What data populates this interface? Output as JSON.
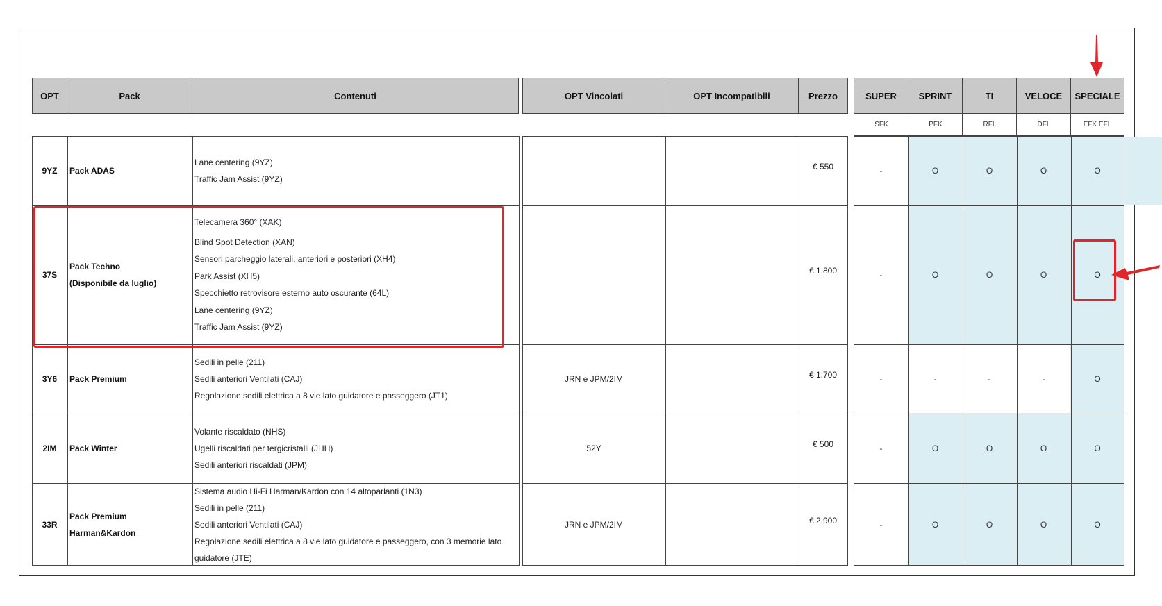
{
  "headers": {
    "opt": "OPT",
    "pack": "Pack",
    "contenuti": "Contenuti",
    "vincolati": "OPT Vincolati",
    "incompatibili": "OPT Incompatibili",
    "prezzo": "Prezzo"
  },
  "trims": [
    {
      "name": "SUPER",
      "code": "SFK"
    },
    {
      "name": "SPRINT",
      "code": "PFK"
    },
    {
      "name": "TI",
      "code": "RFL"
    },
    {
      "name": "VELOCE",
      "code": "DFL"
    },
    {
      "name": "SPECIALE",
      "code": "EFK EFL"
    }
  ],
  "rows": [
    {
      "opt": "9YZ",
      "pack": [
        "Pack ADAS"
      ],
      "contents": [
        "Lane centering (9YZ)",
        "Traffic Jam Assist (9YZ)"
      ],
      "vincolati": "",
      "incompatibili": "",
      "price": "€ 550",
      "trims": [
        "-",
        "O",
        "O",
        "O",
        "O"
      ]
    },
    {
      "opt": "37S",
      "pack": [
        "Pack Techno",
        "(Disponibile da luglio)"
      ],
      "contents": [
        "Telecamera 360° (XAK)",
        "Blind Spot Detection (XAN)",
        "Sensori parcheggio laterali, anteriori e posteriori (XH4)",
        "Park Assist (XH5)",
        "Specchietto retrovisore esterno auto oscurante (64L)",
        "Lane centering (9YZ)",
        "Traffic Jam Assist (9YZ)"
      ],
      "vincolati": "",
      "incompatibili": "",
      "price": "€ 1.800",
      "trims": [
        "-",
        "O",
        "O",
        "O",
        "O"
      ]
    },
    {
      "opt": "3Y6",
      "pack": [
        "Pack Premium"
      ],
      "contents": [
        "Sedili in pelle (211)",
        "Sedili anteriori Ventilati (CAJ)",
        "Regolazione sedili elettrica a 8 vie lato guidatore e passeggero (JT1)"
      ],
      "vincolati": "JRN e JPM/2IM",
      "incompatibili": "",
      "price": "€ 1.700",
      "trims": [
        "-",
        "-",
        "-",
        "-",
        "O"
      ]
    },
    {
      "opt": "2IM",
      "pack": [
        "Pack Winter"
      ],
      "contents": [
        "Volante riscaldato (NHS)",
        "Ugelli riscaldati per tergicristalli (JHH)",
        "Sedili anteriori riscaldati (JPM)"
      ],
      "vincolati": "52Y",
      "incompatibili": "",
      "price": "€ 500",
      "trims": [
        "-",
        "O",
        "O",
        "O",
        "O"
      ]
    },
    {
      "opt": "33R",
      "pack": [
        "Pack Premium",
        "Harman&Kardon"
      ],
      "contents": [
        "Sistema audio Hi-Fi Harman/Kardon con 14 altoparlanti (1N3)",
        "Sedili in pelle (211)",
        "Sedili anteriori Ventilati (CAJ)",
        "Regolazione sedili elettrica a 8 vie lato guidatore e passeggero, con 3 memorie lato",
        "guidatore (JTE)"
      ],
      "vincolati": "JRN e JPM/2IM",
      "incompatibili": "",
      "price": "€ 2.900",
      "trims": [
        "-",
        "O",
        "O",
        "O",
        "O"
      ]
    }
  ],
  "colors": {
    "header_bg": "#c9c9c9",
    "shade": "#dbeef4",
    "highlight": "#e0262a"
  }
}
